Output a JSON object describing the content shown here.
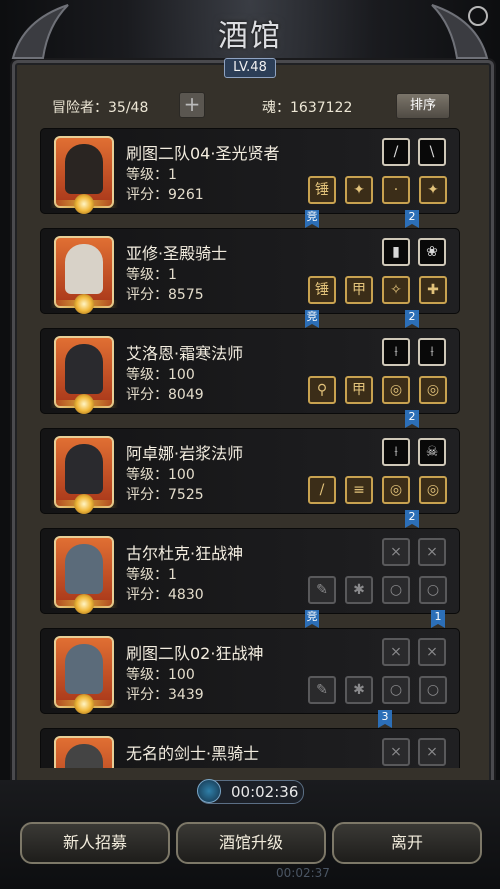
{
  "tavern": {
    "title": "酒馆",
    "level": "LV.48"
  },
  "info": {
    "adventurers": "冒险者：35/48",
    "add_symbol": "+",
    "souls": "魂：1637122",
    "sort_label": "排序"
  },
  "heroes": [
    {
      "name": "刷图二队04·圣光贤者",
      "level": "等级：1",
      "score": "评分：9261",
      "top_slots": [
        "/",
        "\\"
      ],
      "gear_slots": [
        "锤",
        "✦",
        "·",
        "✦"
      ],
      "tags": [
        "竞",
        "2"
      ]
    },
    {
      "name": "亚修·圣殿骑士",
      "level": "等级：1",
      "score": "评分：8575",
      "top_slots": [
        "▮",
        "❀"
      ],
      "gear_slots": [
        "锤",
        "甲",
        "✧",
        "✚"
      ],
      "tags": [
        "竞",
        "2"
      ]
    },
    {
      "name": "艾洛恩·霜寒法师",
      "level": "等级：100",
      "score": "评分：8049",
      "top_slots": [
        "⟊",
        "⟊"
      ],
      "gear_slots": [
        "⚲",
        "甲",
        "◎",
        "◎"
      ],
      "tags": [
        "2"
      ]
    },
    {
      "name": "阿卓娜·岩浆法师",
      "level": "等级：100",
      "score": "评分：7525",
      "top_slots": [
        "⟊",
        "☠"
      ],
      "gear_slots": [
        "/",
        "≡",
        "◎",
        "◎"
      ],
      "tags": [
        "2"
      ]
    },
    {
      "name": "古尔杜克·狂战神",
      "level": "等级：1",
      "score": "评分：4830",
      "top_slots": [
        "⨯",
        "⨯"
      ],
      "gear_slots": [
        "✎",
        "✱",
        "○",
        "○"
      ],
      "tags": [
        "竞",
        "1"
      ]
    },
    {
      "name": "刷图二队02·狂战神",
      "level": "等级：100",
      "score": "评分：3439",
      "top_slots": [
        "⨯",
        "⨯"
      ],
      "gear_slots": [
        "✎",
        "✱",
        "○",
        "○"
      ],
      "tags": [
        "3"
      ]
    },
    {
      "name": "无名的剑士·黑骑士",
      "level": "",
      "score": "",
      "top_slots": [
        "⨯",
        "⨯"
      ],
      "gear_slots": [],
      "tags": []
    }
  ],
  "timer": {
    "value": "00:02:36",
    "ghost": "00:02:37"
  },
  "nav": {
    "recruit": "新人招募",
    "upgrade": "酒馆升级",
    "leave": "离开"
  }
}
